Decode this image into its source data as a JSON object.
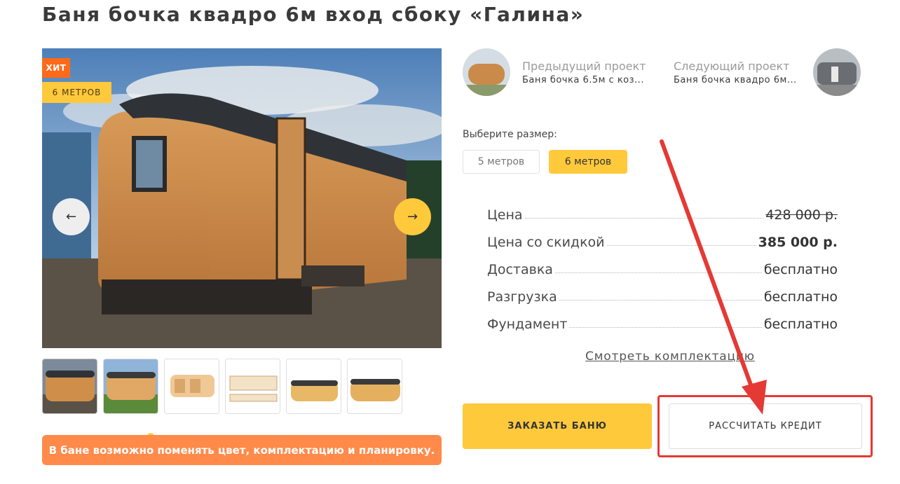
{
  "page": {
    "title": "Баня бочка квадро 6м вход сбоку «Галина»"
  },
  "gallery": {
    "badge_hit": "ХИТ",
    "badge_size": "6 МЕТРОВ",
    "prev_arrow": "←",
    "next_arrow": "→",
    "thumbnail_count": 6,
    "notice": "В бане возможно поменять цвет, комплектацию и планировку."
  },
  "navigation": {
    "prev_label": "Предыдущий проект",
    "prev_name": "Баня бочка 6.5м с коз...",
    "next_label": "Следующий проект",
    "next_name": "Баня бочка квадро 6м..."
  },
  "size_selector": {
    "label": "Выберите размер:",
    "options": [
      "5 метров",
      "6 метров"
    ],
    "selected": "6 метров"
  },
  "pricing": {
    "rows": [
      {
        "label": "Цена",
        "value": "428 000 р."
      },
      {
        "label": "Цена со скидкой",
        "value": "385 000 р."
      },
      {
        "label": "Доставка",
        "value": "бесплатно"
      },
      {
        "label": "Разгрузка",
        "value": "бесплатно"
      },
      {
        "label": "Фундамент",
        "value": "бесплатно"
      }
    ],
    "details_link": "Смотреть комплектацию"
  },
  "actions": {
    "order": "ЗАКАЗАТЬ БАНЮ",
    "credit": "РАССЧИТАТЬ КРЕДИТ"
  },
  "colors": {
    "accent_yellow": "#ffc93c",
    "accent_orange": "#ff6a1a",
    "annotation_red": "#e53935"
  }
}
